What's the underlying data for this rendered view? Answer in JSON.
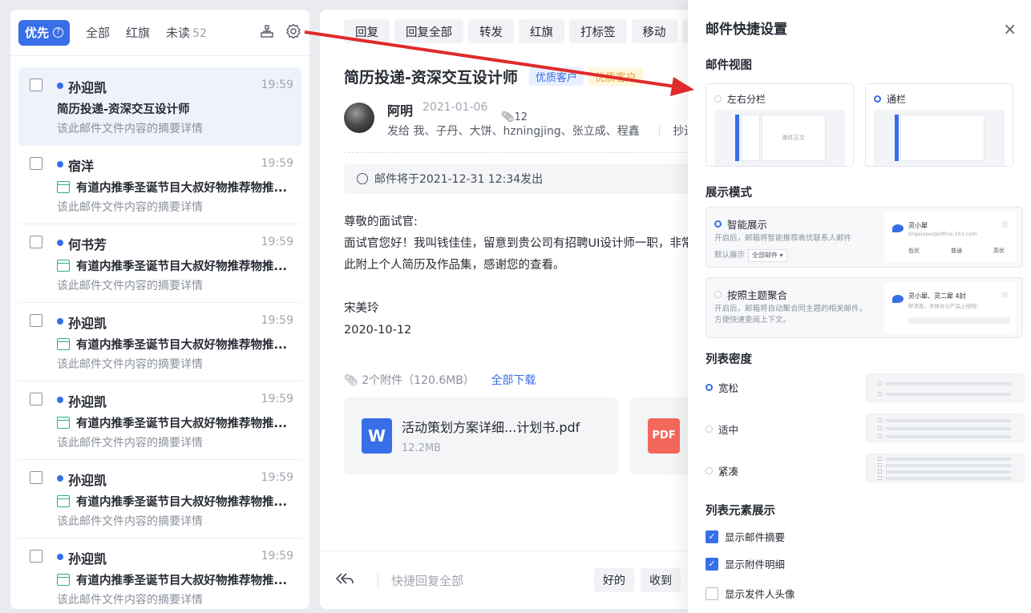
{
  "list": {
    "priority_label": "优先",
    "help_glyph": "?",
    "tabs": [
      {
        "label": "全部",
        "count": ""
      },
      {
        "label": "红旗",
        "count": ""
      },
      {
        "label": "未读",
        "count": "52"
      }
    ],
    "mails": [
      {
        "from": "孙迎凯",
        "time": "19:59",
        "subject": "简历投递-资深交互设计师",
        "summary": "该此邮件文件内容的摘要详情",
        "calendar": false
      },
      {
        "from": "宿洋",
        "time": "19:59",
        "subject": "有道内推季圣诞节目大叔好物推荐物推...",
        "summary": "该此邮件文件内容的摘要详情",
        "calendar": true
      },
      {
        "from": "何书芳",
        "time": "19:59",
        "subject": "有道内推季圣诞节目大叔好物推荐物推...",
        "summary": "该此邮件文件内容的摘要详情",
        "calendar": true
      },
      {
        "from": "孙迎凯",
        "time": "19:59",
        "subject": "有道内推季圣诞节目大叔好物推荐物推...",
        "summary": "该此邮件文件内容的摘要详情",
        "calendar": true
      },
      {
        "from": "孙迎凯",
        "time": "19:59",
        "subject": "有道内推季圣诞节目大叔好物推荐物推...",
        "summary": "该此邮件文件内容的摘要详情",
        "calendar": true
      },
      {
        "from": "孙迎凯",
        "time": "19:59",
        "subject": "有道内推季圣诞节目大叔好物推荐物推...",
        "summary": "该此邮件文件内容的摘要详情",
        "calendar": true
      },
      {
        "from": "孙迎凯",
        "time": "19:59",
        "subject": "有道内推季圣诞节目大叔好物推荐物推...",
        "summary": "该此邮件文件内容的摘要详情",
        "calendar": true
      }
    ]
  },
  "reader": {
    "toolbar": [
      "回复",
      "回复全部",
      "转发",
      "红旗",
      "打标签",
      "移动",
      ""
    ],
    "title": "简历投递-资深交互设计师",
    "tags": [
      "优质客户",
      "优质客户"
    ],
    "sender": "阿明",
    "date": "2021-01-06",
    "attachment_count": "12",
    "recipients": "发给 我、子丹、大饼、hzningjing、张立成、程鑫",
    "cc": "抄送",
    "schedule": "邮件将于2021-12-31 12:34发出",
    "body": [
      "尊敬的面试官:",
      "面试官您好！我叫钱佳佳，留意到贵公司有招聘UI设计师一职，非常",
      "此附上个人简历及作品集，感谢您的查看。",
      "",
      "宋美玲",
      "2020-10-12"
    ],
    "attachments_summary": "2个附件（120.6MB）",
    "download_all": "全部下载",
    "attachments": [
      {
        "name": "活动策划方案详细...计划书.pdf",
        "size": "12.2MB",
        "icon_text": "W"
      },
      {
        "name": "",
        "size": "",
        "icon_text": "PDF"
      }
    ],
    "quick_reply_placeholder": "快捷回复全部",
    "quick_buttons": [
      "好的",
      "收到"
    ]
  },
  "settings": {
    "title": "邮件快捷设置",
    "close": "×",
    "view_section": "邮件视图",
    "views": [
      {
        "label": "左右分栏",
        "selected": false,
        "preview_text": "邮件正文"
      },
      {
        "label": "通栏",
        "selected": true,
        "preview_text": ""
      }
    ],
    "mode_section": "展示模式",
    "modes": [
      {
        "label": "智能展示",
        "selected": true,
        "desc_line1": "开启后，邮箱将智能推荐高优联系人邮件",
        "desc_line2": "默认展示",
        "select_value": "全部邮件",
        "preview_name": "灵小犀",
        "preview_mail": "lingxiaoxi@office.163.com",
        "preview_levels": [
          "低优",
          "普通",
          "高优"
        ]
      },
      {
        "label": "按照主题聚合",
        "selected": false,
        "desc_line1": "开启后，邮箱将自动聚合同主题的相关邮件，方便快速查阅上下文。",
        "preview_name": "灵小犀、灵二犀",
        "preview_count": "4封",
        "preview_mail": "好消息，灵犀办公产品上线啦！"
      }
    ],
    "density_section": "列表密度",
    "densities": [
      {
        "label": "宽松",
        "selected": true
      },
      {
        "label": "适中",
        "selected": false
      },
      {
        "label": "紧凑",
        "selected": false
      }
    ],
    "elements_section": "列表元素展示",
    "elements": [
      {
        "label": "显示邮件摘要",
        "checked": true
      },
      {
        "label": "显示附件明细",
        "checked": true
      },
      {
        "label": "显示发件人头像",
        "checked": false
      }
    ]
  },
  "colors": {
    "accent": "#386ee7",
    "calendar": "#1fb58c",
    "arrow": "#e02a2a",
    "pdf": "#f3685b"
  }
}
